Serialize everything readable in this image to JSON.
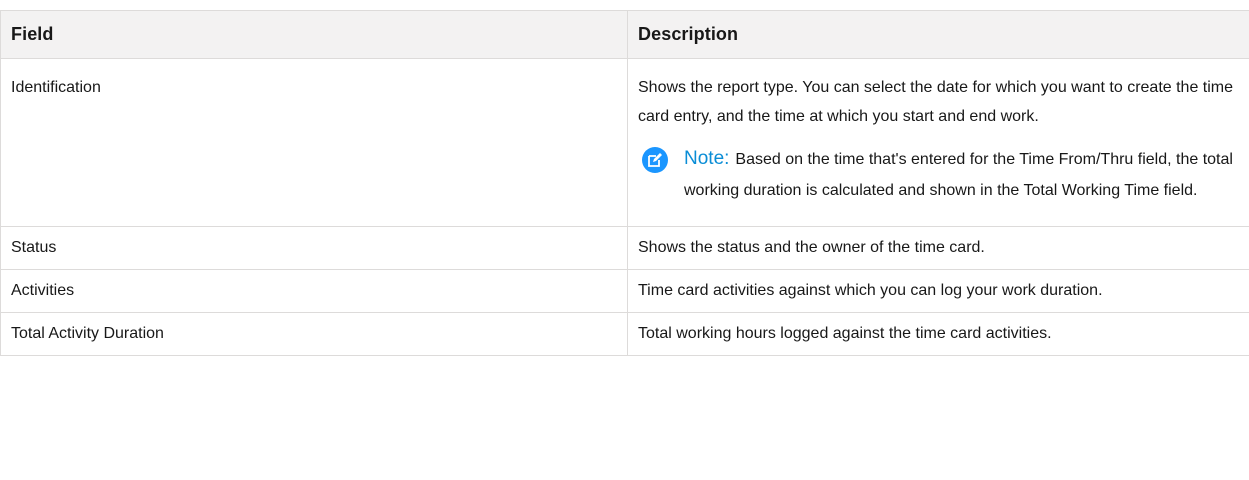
{
  "table": {
    "headers": {
      "field": "Field",
      "description": "Description"
    },
    "rows": [
      {
        "field": "Identification",
        "description": "Shows the report type. You can select the date for which you want to create the time card entry, and the time at which you start and end work.",
        "note": {
          "icon": "edit-note-icon",
          "label": "Note:",
          "text": "Based on the time that's entered for the Time From/Thru field, the total working duration is calculated and shown in the Total Working Time field."
        }
      },
      {
        "field": "Status",
        "description": "Shows the status and the owner of the time card."
      },
      {
        "field": "Activities",
        "description": "Time card activities against which you can log your work duration."
      },
      {
        "field": "Total Activity Duration",
        "description": "Total working hours logged against the time card activities."
      }
    ]
  },
  "colors": {
    "header_bg": "#f3f2f2",
    "border": "#dddbda",
    "note_accent": "#0a8dd6",
    "note_icon_bg": "#1b96ff"
  }
}
